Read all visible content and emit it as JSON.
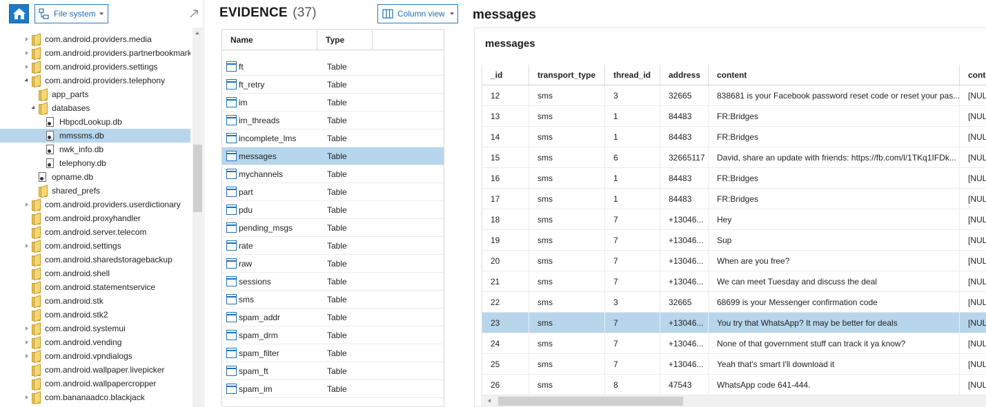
{
  "left": {
    "filesystem_label": "File system",
    "tree": [
      {
        "label": "com.android.providers.media",
        "level": 1,
        "arrow": "r",
        "type": "folder"
      },
      {
        "label": "com.android.providers.partnerbookmarks",
        "level": 1,
        "arrow": "r",
        "type": "folder"
      },
      {
        "label": "com.android.providers.settings",
        "level": 1,
        "arrow": "r",
        "type": "folder"
      },
      {
        "label": "com.android.providers.telephony",
        "level": 1,
        "arrow": "d",
        "type": "folder"
      },
      {
        "label": "app_parts",
        "level": 2,
        "arrow": "",
        "type": "folder"
      },
      {
        "label": "databases",
        "level": 2,
        "arrow": "d",
        "type": "folder"
      },
      {
        "label": "HbpcdLookup.db",
        "level": 3,
        "arrow": "",
        "type": "db"
      },
      {
        "label": "mmssms.db",
        "level": 3,
        "arrow": "",
        "type": "db",
        "selected": true
      },
      {
        "label": "nwk_info.db",
        "level": 3,
        "arrow": "",
        "type": "db"
      },
      {
        "label": "telephony.db",
        "level": 3,
        "arrow": "",
        "type": "db"
      },
      {
        "label": "opname.db",
        "level": 2,
        "arrow": "",
        "type": "db"
      },
      {
        "label": "shared_prefs",
        "level": 2,
        "arrow": "",
        "type": "folder"
      },
      {
        "label": "com.android.providers.userdictionary",
        "level": 1,
        "arrow": "r",
        "type": "folder"
      },
      {
        "label": "com.android.proxyhandler",
        "level": 1,
        "arrow": "",
        "type": "folder"
      },
      {
        "label": "com.android.server.telecom",
        "level": 1,
        "arrow": "",
        "type": "folder"
      },
      {
        "label": "com.android.settings",
        "level": 1,
        "arrow": "r",
        "type": "folder"
      },
      {
        "label": "com.android.sharedstoragebackup",
        "level": 1,
        "arrow": "",
        "type": "folder"
      },
      {
        "label": "com.android.shell",
        "level": 1,
        "arrow": "",
        "type": "folder"
      },
      {
        "label": "com.android.statementservice",
        "level": 1,
        "arrow": "",
        "type": "folder"
      },
      {
        "label": "com.android.stk",
        "level": 1,
        "arrow": "",
        "type": "folder"
      },
      {
        "label": "com.android.stk2",
        "level": 1,
        "arrow": "",
        "type": "folder"
      },
      {
        "label": "com.android.systemui",
        "level": 1,
        "arrow": "r",
        "type": "folder"
      },
      {
        "label": "com.android.vending",
        "level": 1,
        "arrow": "r",
        "type": "folder"
      },
      {
        "label": "com.android.vpndialogs",
        "level": 1,
        "arrow": "r",
        "type": "folder"
      },
      {
        "label": "com.android.wallpaper.livepicker",
        "level": 1,
        "arrow": "",
        "type": "folder"
      },
      {
        "label": "com.android.wallpapercropper",
        "level": 1,
        "arrow": "",
        "type": "folder"
      },
      {
        "label": "com.bananaadco.blackjack",
        "level": 1,
        "arrow": "r",
        "type": "folder"
      }
    ]
  },
  "middle": {
    "title": "EVIDENCE",
    "count": "(37)",
    "view_label": "Column view",
    "headers": {
      "name": "Name",
      "type": "Type"
    },
    "rows": [
      {
        "name": "ft",
        "type": "Table"
      },
      {
        "name": "ft_retry",
        "type": "Table"
      },
      {
        "name": "im",
        "type": "Table"
      },
      {
        "name": "im_threads",
        "type": "Table"
      },
      {
        "name": "incomplete_lms",
        "type": "Table"
      },
      {
        "name": "messages",
        "type": "Table",
        "selected": true
      },
      {
        "name": "mychannels",
        "type": "Table"
      },
      {
        "name": "part",
        "type": "Table"
      },
      {
        "name": "pdu",
        "type": "Table"
      },
      {
        "name": "pending_msgs",
        "type": "Table"
      },
      {
        "name": "rate",
        "type": "Table"
      },
      {
        "name": "raw",
        "type": "Table"
      },
      {
        "name": "sessions",
        "type": "Table"
      },
      {
        "name": "sms",
        "type": "Table"
      },
      {
        "name": "spam_addr",
        "type": "Table"
      },
      {
        "name": "spam_drm",
        "type": "Table"
      },
      {
        "name": "spam_filter",
        "type": "Table"
      },
      {
        "name": "spam_ft",
        "type": "Table"
      },
      {
        "name": "spam_im",
        "type": "Table"
      }
    ]
  },
  "right": {
    "title": "messages",
    "subtitle": "messages",
    "columns": [
      "_id",
      "transport_type",
      "thread_id",
      "address",
      "content",
      "conte"
    ],
    "rows": [
      {
        "id": "12",
        "transport": "sms",
        "thread": "3",
        "address": "32665",
        "content": "838681 is your Facebook password reset code or reset your pas...",
        "extra": "[NULL"
      },
      {
        "id": "13",
        "transport": "sms",
        "thread": "1",
        "address": "84483",
        "content": "FR:Bridges",
        "extra": "[NULL"
      },
      {
        "id": "14",
        "transport": "sms",
        "thread": "1",
        "address": "84483",
        "content": "FR:Bridges",
        "extra": "[NULL"
      },
      {
        "id": "15",
        "transport": "sms",
        "thread": "6",
        "address": "32665117",
        "content": "David, share an update with friends: https://fb.com/l/1TKq1IFDk...",
        "extra": "[NULL"
      },
      {
        "id": "16",
        "transport": "sms",
        "thread": "1",
        "address": "84483",
        "content": "FR:Bridges",
        "extra": "[NULL"
      },
      {
        "id": "17",
        "transport": "sms",
        "thread": "1",
        "address": "84483",
        "content": "FR:Bridges",
        "extra": "[NULL"
      },
      {
        "id": "18",
        "transport": "sms",
        "thread": "7",
        "address": "+13046...",
        "content": "Hey",
        "extra": "[NULL"
      },
      {
        "id": "19",
        "transport": "sms",
        "thread": "7",
        "address": "+13046...",
        "content": "Sup",
        "extra": "[NULL"
      },
      {
        "id": "20",
        "transport": "sms",
        "thread": "7",
        "address": "+13046...",
        "content": "When are you free?",
        "extra": "[NULL"
      },
      {
        "id": "21",
        "transport": "sms",
        "thread": "7",
        "address": "+13046...",
        "content": "We can meet Tuesday and discuss the deal",
        "extra": "[NULL"
      },
      {
        "id": "22",
        "transport": "sms",
        "thread": "3",
        "address": "32665",
        "content": "68699 is your Messenger confirmation code",
        "extra": "[NULL"
      },
      {
        "id": "23",
        "transport": "sms",
        "thread": "7",
        "address": "+13046...",
        "content": "You try that WhatsApp? It may be better for deals",
        "extra": "[NULL",
        "selected": true
      },
      {
        "id": "24",
        "transport": "sms",
        "thread": "7",
        "address": "+13046...",
        "content": "None of that government stuff can track it ya know?",
        "extra": "[NULL"
      },
      {
        "id": "25",
        "transport": "sms",
        "thread": "7",
        "address": "+13046...",
        "content": "Yeah that's smart I'll download it",
        "extra": "[NULL"
      },
      {
        "id": "26",
        "transport": "sms",
        "thread": "8",
        "address": "47543",
        "content": "WhatsApp code 641-444.",
        "extra": "[NULL"
      }
    ]
  },
  "colors": {
    "accent": "#1e7bc8",
    "selection": "#b7d6ec"
  }
}
